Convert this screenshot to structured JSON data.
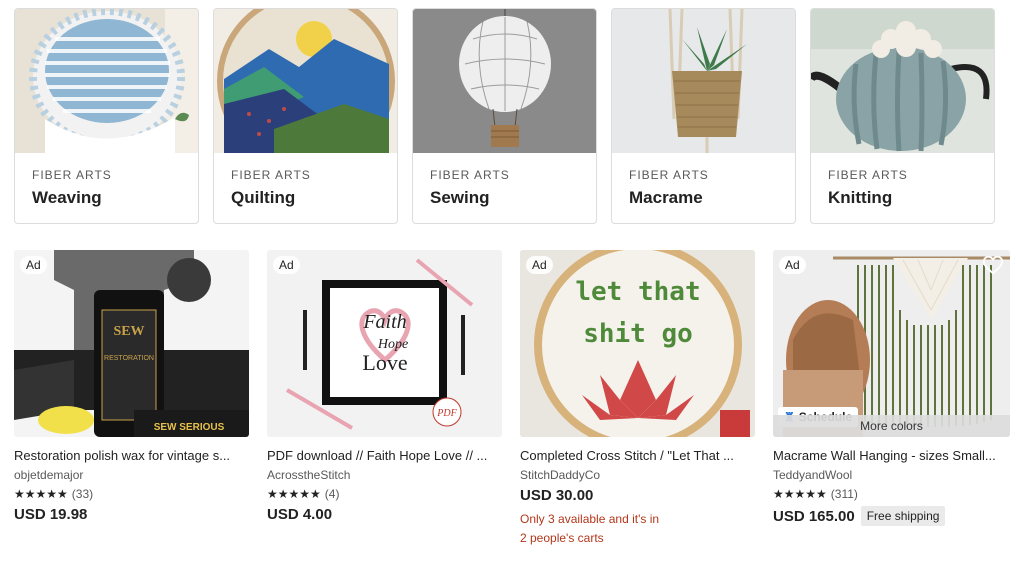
{
  "categories": [
    {
      "kicker": "FIBER ARTS",
      "title": "Weaving"
    },
    {
      "kicker": "FIBER ARTS",
      "title": "Quilting"
    },
    {
      "kicker": "FIBER ARTS",
      "title": "Sewing"
    },
    {
      "kicker": "FIBER ARTS",
      "title": "Macrame"
    },
    {
      "kicker": "FIBER ARTS",
      "title": "Knitting"
    }
  ],
  "listings": [
    {
      "ad": "Ad",
      "title": "Restoration polish wax for vintage s...",
      "shop": "objetdemajor",
      "stars": "★★★★★",
      "count": "(33)",
      "price": "USD 19.98",
      "image_text_1": "SEW",
      "image_text_2": "RESTORATION",
      "image_text_3": "SEW SERIOUS"
    },
    {
      "ad": "Ad",
      "title": "PDF download // Faith Hope Love // ...",
      "shop": "AcrosstheStitch",
      "stars": "★★★★★",
      "count": "(4)",
      "price": "USD 4.00",
      "image_text_1": "Faith",
      "image_text_2": "Hope",
      "image_text_3": "Love",
      "image_text_4": "PDF"
    },
    {
      "ad": "Ad",
      "title": "Completed Cross Stitch / \"Let That ...",
      "shop": "StitchDaddyCo",
      "price": "USD 30.00",
      "scarcity_1": "Only 3 available and it's in",
      "scarcity_2": "2 people's carts",
      "image_text_1": "let that",
      "image_text_2": "shit go"
    },
    {
      "ad": "Ad",
      "title": "Macrame Wall Hanging - sizes Small...",
      "shop": "TeddyandWool",
      "stars": "★★★★★",
      "count": "(311)",
      "price": "USD 165.00",
      "free_shipping": "Free shipping",
      "schedule": "Schedule",
      "more_colors": "More colors"
    }
  ]
}
